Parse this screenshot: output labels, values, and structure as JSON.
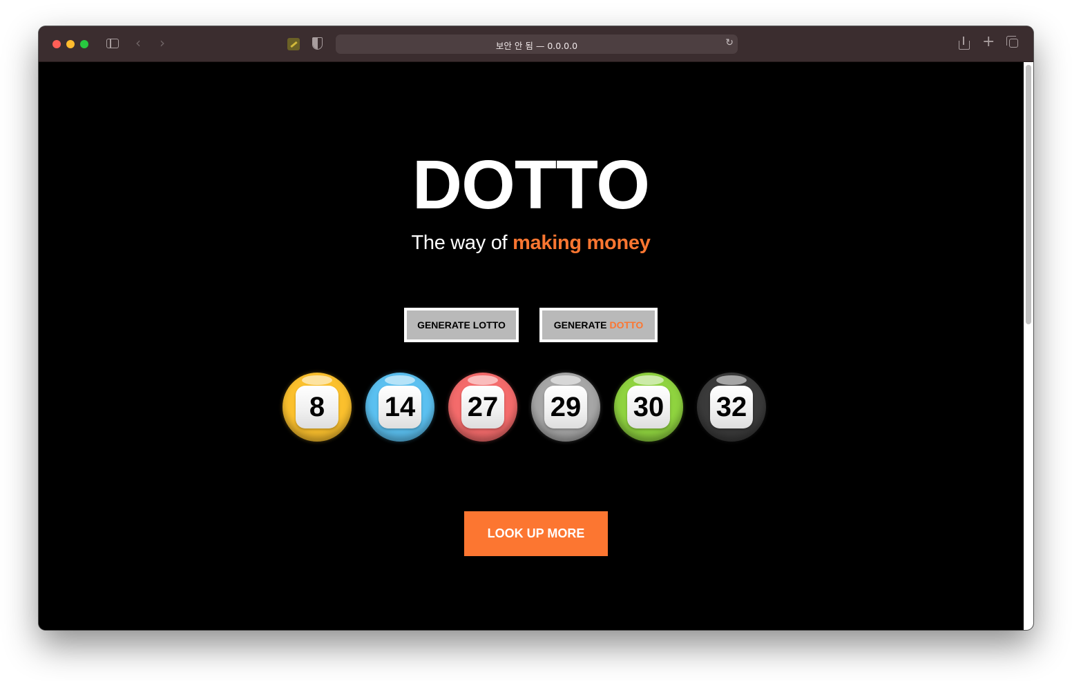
{
  "browser": {
    "address": "보안 안 됨 — 0.0.0.0"
  },
  "hero": {
    "title": "DOTTO",
    "tagline_prefix": "The way of ",
    "tagline_accent": "making money"
  },
  "buttons": {
    "generate_lotto": "GENERATE LOTTO",
    "generate_dotto_prefix": "GENERATE",
    "generate_dotto_accent": "DOTTO",
    "look_up_more": "LOOK UP MORE"
  },
  "balls": [
    {
      "number": "8",
      "color": "#fbc02d"
    },
    {
      "number": "14",
      "color": "#5bc0f0"
    },
    {
      "number": "27",
      "color": "#f46b6b"
    },
    {
      "number": "29",
      "color": "#a6a6a6"
    },
    {
      "number": "30",
      "color": "#8fd33f"
    },
    {
      "number": "32",
      "color": "#3a3a3a"
    }
  ],
  "colors": {
    "accent": "#fc7631",
    "background": "#000000"
  }
}
